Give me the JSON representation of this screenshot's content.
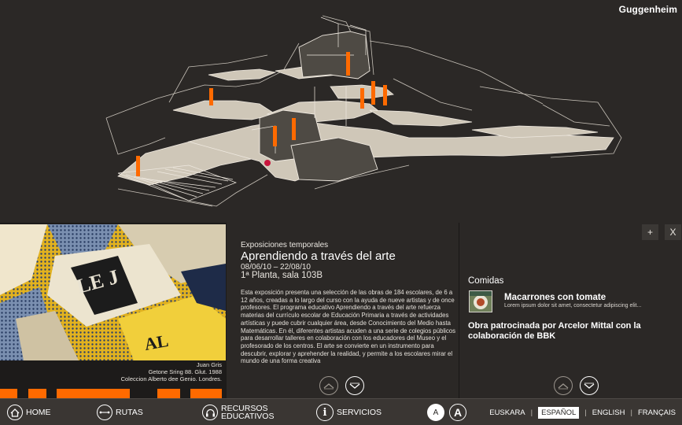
{
  "brand": "Guggenheim",
  "exhibition": {
    "kicker": "Exposiciones temporales",
    "title": "Aprendiendo a través del arte",
    "dates": "08/06/10 – 22/08/10",
    "room": "1ª Planta, sala 103B",
    "description": "Esta exposición presenta una selección de las obras de 184 escolares, de 6 a 12 años, creadas a lo largo del curso con la ayuda de nueve artistas y de once profesores. El programa educativo Aprendiendo a través del arte refuerza materias del currículo escolar de Educación Primaria a través de actividades artísticas y puede cubrir cualquier área, desde Conocimiento del Medio hasta Matemáticas. En él, diferentes artistas acuden a una serie de colegios públicos para desarrollar talleres en colaboración con los educadores del Museo y el profesorado de los centros. El arte se convierte en un instrumento para descubrir, explorar y aprehender la realidad, y permite a los escolares mirar el mundo de una forma creativa"
  },
  "artwork": {
    "artist": "Juan Gris",
    "work": "Getone Sring 88. Glut. 1988",
    "collection": "Coleccion Alberto dee Genio. Londres."
  },
  "food": {
    "heading": "Comidas",
    "dish": "Macarrones con tomate",
    "dish_desc": "Lorem ipsum dolor sit amet, consectetur adipiscing elit...",
    "sponsor": "Obra patrocinada por Arcelor Mittal con la colaboración de BBK"
  },
  "controls": {
    "plus": "+",
    "close": "X"
  },
  "nav": {
    "home": "HOME",
    "rutas": "RUTAS",
    "recursos_1": "RECURSOS",
    "recursos_2": "EDUCATIVOS",
    "servicios": "SERVICIOS",
    "font_small": "A",
    "font_large": "A"
  },
  "languages": [
    "EUSKARA",
    "ESPAÑOL",
    "ENGLISH",
    "FRANÇAIS"
  ],
  "colors": {
    "accent": "#ff6a00",
    "background": "#2b2826",
    "nav_bar": "#3a3633"
  }
}
